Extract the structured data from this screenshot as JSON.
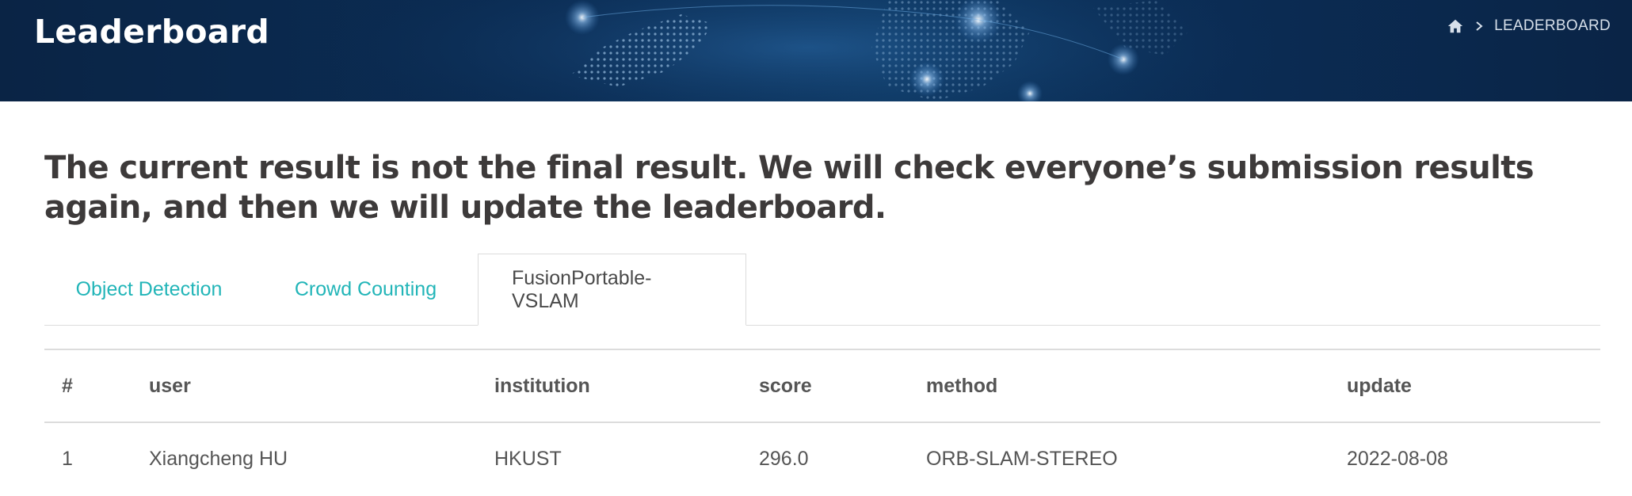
{
  "header": {
    "title": "Leaderboard",
    "breadcrumb": {
      "home_icon": "home-icon",
      "separator_icon": "chevron-right-icon",
      "current": "LEADERBOARD"
    }
  },
  "notice": "The current result is not the final result. We will check everyone’s submission results again, and then we will update the leaderboard.",
  "tabs": [
    {
      "label": "Object Detection",
      "active": false
    },
    {
      "label": "Crowd Counting",
      "active": false
    },
    {
      "label": "FusionPortable-VSLAM",
      "active": true
    }
  ],
  "table": {
    "columns": [
      "#",
      "user",
      "institution",
      "score",
      "method",
      "update"
    ],
    "rows": [
      [
        "1",
        "Xiangcheng HU",
        "HKUST",
        "296.0",
        "ORB-SLAM-STEREO",
        "2022-08-08"
      ]
    ]
  },
  "colors": {
    "banner": "#0b2d55",
    "tab_link": "#22b5b8",
    "text": "#3d3a3a"
  }
}
